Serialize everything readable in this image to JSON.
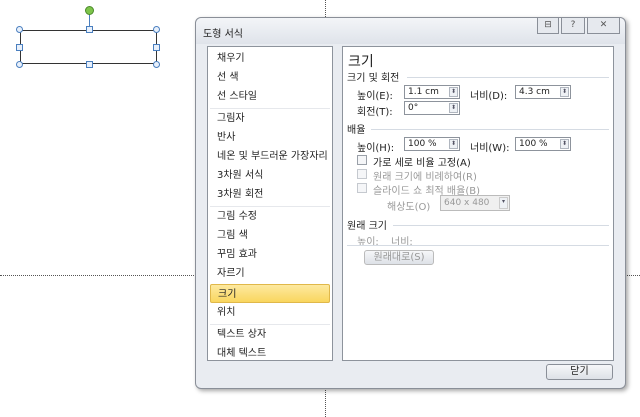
{
  "dialog": {
    "title": "도형 서식",
    "buttons": {
      "minimize": "⊟",
      "help": "?",
      "close": "✕"
    },
    "close_label": "닫기"
  },
  "sidebar": {
    "items": [
      {
        "label": "채우기"
      },
      {
        "label": "선 색"
      },
      {
        "label": "선 스타일"
      },
      {
        "label": "그림자"
      },
      {
        "label": "반사"
      },
      {
        "label": "네온 및 부드러운 가장자리"
      },
      {
        "label": "3차원 서식"
      },
      {
        "label": "3차원 회전"
      },
      {
        "label": "그림 수정"
      },
      {
        "label": "그림 색"
      },
      {
        "label": "꾸밈 효과"
      },
      {
        "label": "자르기"
      },
      {
        "label": "크기"
      },
      {
        "label": "위치"
      },
      {
        "label": "텍스트 상자"
      },
      {
        "label": "대체 텍스트"
      }
    ],
    "selected": "크기"
  },
  "panel": {
    "heading": "크기",
    "size_rotate": {
      "title": "크기 및 회전",
      "height_label": "높이(E):",
      "height_value": "1.1 cm",
      "width_label": "너비(D):",
      "width_value": "4.3 cm",
      "rotation_label": "회전(T):",
      "rotation_value": "0°"
    },
    "scale": {
      "title": "배율",
      "height_label": "높이(H):",
      "height_value": "100 %",
      "width_label": "너비(W):",
      "width_value": "100 %",
      "lock_aspect": "가로 세로 비율 고정(A)",
      "relative_original": "원래 크기에 비례하여(R)",
      "best_scale": "슬라이드 쇼 최적 배율(B)",
      "resolution_label": "해상도(O)",
      "resolution_value": "640 x 480"
    },
    "original": {
      "title": "원래 크기",
      "height_label": "높이:",
      "width_label": "너비:",
      "reset_label": "원래대로(S)"
    }
  }
}
